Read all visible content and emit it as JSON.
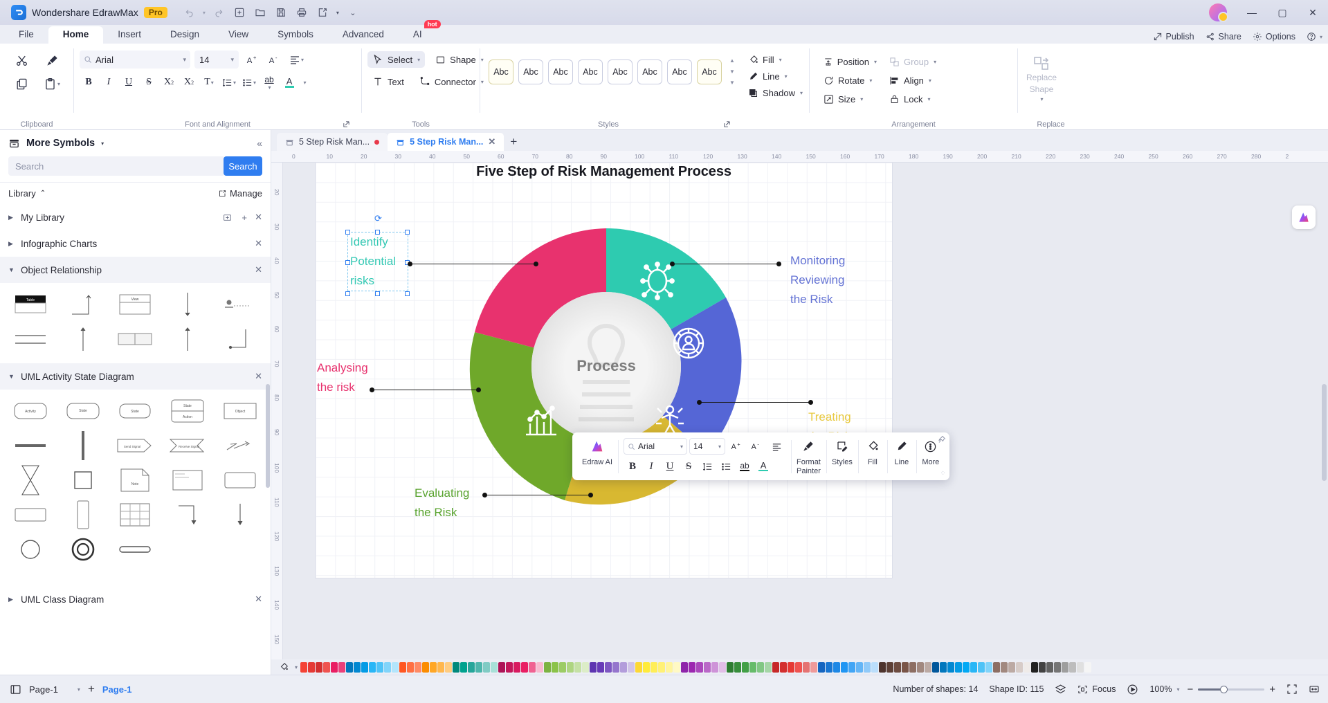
{
  "app": {
    "title": "Wondershare EdrawMax",
    "badge": "Pro"
  },
  "titlebar_icons": [
    "undo-icon",
    "redo-icon",
    "new-icon",
    "open-icon",
    "save-icon",
    "print-icon",
    "export-icon",
    "more-icon"
  ],
  "window_controls": {
    "minimize": "—",
    "maximize": "▢",
    "close": "✕"
  },
  "menu": {
    "items": [
      "File",
      "Home",
      "Insert",
      "Design",
      "View",
      "Symbols",
      "Advanced",
      "AI"
    ],
    "active": "Home",
    "ai_badge": "hot",
    "right": {
      "publish": "Publish",
      "share": "Share",
      "options": "Options",
      "help": "?"
    }
  },
  "ribbon": {
    "groups": [
      "Clipboard",
      "Font and Alignment",
      "Tools",
      "Styles",
      "Arrangement",
      "Replace"
    ],
    "clipboard": {
      "cut": "cut-icon",
      "format_painter": "format-painter-icon",
      "copy": "copy-icon",
      "paste": "paste-icon"
    },
    "font": {
      "family": "Arial",
      "family_placeholder": "Arial",
      "size": "14",
      "buttons": [
        "grow-font",
        "shrink-font",
        "align",
        "bold",
        "italic",
        "underline",
        "strikethrough",
        "superscript",
        "subscript",
        "text-case",
        "line-spacing",
        "bullets",
        "highlight",
        "font-color"
      ]
    },
    "tools": {
      "select": "Select",
      "shape": "Shape",
      "text": "Text",
      "connector": "Connector"
    },
    "styles": {
      "swatches": [
        "Abc",
        "Abc",
        "Abc",
        "Abc",
        "Abc",
        "Abc",
        "Abc",
        "Abc"
      ]
    },
    "fill_group": {
      "fill": "Fill",
      "line": "Line",
      "shadow": "Shadow"
    },
    "arrangement": {
      "position": "Position",
      "group": "Group",
      "rotate": "Rotate",
      "align": "Align",
      "size": "Size",
      "lock": "Lock"
    },
    "replace": {
      "label_line1": "Replace",
      "label_line2": "Shape"
    }
  },
  "sidebar": {
    "header": "More Symbols",
    "search_placeholder": "Search",
    "search_button": "Search",
    "library_label": "Library",
    "manage_label": "Manage",
    "categories": [
      {
        "name": "My Library",
        "open": false
      },
      {
        "name": "Infographic Charts",
        "open": false
      },
      {
        "name": "Object Relationship",
        "open": true
      },
      {
        "name": "UML Activity State Diagram",
        "open": true
      },
      {
        "name": "UML Class Diagram",
        "open": false
      }
    ],
    "object_relationship_shapes": [
      "table",
      "crows-foot",
      "view",
      "arrow-down",
      "entity-actor",
      "relation-lines",
      "arrow-up",
      "two-cell-table",
      "arrow-up-2",
      "elbow-connector"
    ],
    "uml_shapes": [
      "Activity",
      "State",
      "State",
      "State-Action",
      "Object",
      "bar",
      "Send Signal",
      "Receive Signal",
      "transition",
      "merge",
      "decision",
      "Note",
      "callout",
      "rounded-rect",
      "rect",
      "vertical-bar",
      "grid",
      "elbow",
      "arrow-down",
      "circle",
      "final-state",
      "thick-bar"
    ]
  },
  "document_tabs": [
    {
      "title": "5 Step Risk Man...",
      "modified": true,
      "active": false
    },
    {
      "title": "5 Step Risk Man...",
      "modified": false,
      "active": true
    }
  ],
  "canvas": {
    "diagram_title": "Five Step of Risk Management Process",
    "center_text": "Process",
    "labels": [
      {
        "text": "Identify Potential risks",
        "lines": [
          "Identify",
          "Potential",
          "risks"
        ],
        "color": "#35c9b4",
        "selected": true
      },
      {
        "text": "Monitoring Reviewing the Risk",
        "lines": [
          "Monitoring",
          "Reviewing",
          "the Risk"
        ],
        "color": "#6372d4",
        "selected": false
      },
      {
        "text": "Treating the Risk",
        "lines": [
          "Treating",
          "the Risk"
        ],
        "color": "#e8c93f",
        "selected": false
      },
      {
        "text": "Evaluating the Risk",
        "lines": [
          "Evaluating",
          "the Risk"
        ],
        "color": "#59a32f",
        "selected": false
      },
      {
        "text": "Analysing the risk",
        "lines": [
          "Analysing",
          "the risk"
        ],
        "color": "#e8326e",
        "selected": false
      }
    ],
    "segment_colors": [
      "#2ecbb0",
      "#5566d6",
      "#d8b831",
      "#6fa82a",
      "#e8326e"
    ],
    "segment_icons": [
      "bug-icon",
      "gear-person-icon",
      "person-target-icon",
      "bar-chart-icon",
      "pie-chart-icon"
    ],
    "ruler_h_ticks": [
      "0",
      "10",
      "20",
      "30",
      "40",
      "50",
      "60",
      "70",
      "80",
      "90",
      "100",
      "110",
      "120",
      "130",
      "140",
      "150",
      "160",
      "170",
      "180",
      "190",
      "200",
      "210",
      "220",
      "230",
      "240",
      "250",
      "260",
      "270",
      "280",
      "2"
    ],
    "ruler_v_ticks": [
      "20",
      "30",
      "40",
      "50",
      "60",
      "70",
      "80",
      "90",
      "100",
      "110",
      "120",
      "130",
      "140",
      "150"
    ],
    "ai_badge": "AI"
  },
  "float_toolbar": {
    "edraw_ai": "Edraw AI",
    "font_family": "Arial",
    "font_size": "14",
    "format_painter_l1": "Format",
    "format_painter_l2": "Painter",
    "styles": "Styles",
    "fill": "Fill",
    "line": "Line",
    "more": "More"
  },
  "statusbar": {
    "page_select": "Page-1",
    "add_page": "+",
    "page_tab": "Page-1",
    "shape_count": "Number of shapes: 14",
    "shape_id": "Shape ID: 115",
    "focus": "Focus",
    "zoom": "100%"
  },
  "palette": [
    "#f44336",
    "#e53935",
    "#d32f2f",
    "#ef5350",
    "#e91e63",
    "#ec407a",
    "#0277bd",
    "#0288d1",
    "#039be5",
    "#29b6f6",
    "#4fc3f7",
    "#81d4fa",
    "#b3e5fc",
    "#ff5722",
    "#ff7043",
    "#ff8a65",
    "#fb8c00",
    "#ffa726",
    "#ffb74d",
    "#ffcc80",
    "#00897b",
    "#00a28e",
    "#26a69a",
    "#4db6ac",
    "#80cbc4",
    "#a8e0d8",
    "#ad1457",
    "#c2185b",
    "#d81b60",
    "#e91e63",
    "#f06292",
    "#f8bbd0",
    "#7cb342",
    "#8bc34a",
    "#9ccc65",
    "#aed581",
    "#c5e1a5",
    "#dcedc8",
    "#5e35b1",
    "#673ab7",
    "#7e57c2",
    "#9575cd",
    "#b39ddb",
    "#d1c4e9",
    "#fdd835",
    "#ffeb3b",
    "#ffee58",
    "#fff176",
    "#fff59d",
    "#fff9c4",
    "#8e24aa",
    "#9c27b0",
    "#ab47bc",
    "#ba68c8",
    "#ce93d8",
    "#e1bee7",
    "#2e7d32",
    "#388e3c",
    "#43a047",
    "#66bb6a",
    "#81c784",
    "#a5d6a7",
    "#c62828",
    "#d32f2f",
    "#e53935",
    "#ef5350",
    "#e57373",
    "#ef9a9a",
    "#1565c0",
    "#1976d2",
    "#1e88e5",
    "#2196f3",
    "#42a5f5",
    "#64b5f6",
    "#90caf9",
    "#bbdefb",
    "#4e342e",
    "#5d4037",
    "#6d4c41",
    "#795548",
    "#8d6e63",
    "#a1887f",
    "#bcaaa4",
    "#01579b",
    "#0277bd",
    "#0288d1",
    "#039be5",
    "#03a9f4",
    "#29b6f6",
    "#4fc3f7",
    "#81d4fa",
    "#8d6e63",
    "#a1887f",
    "#bcaaa4",
    "#d7ccc8",
    "#efebe9",
    "#212121",
    "#424242",
    "#616161",
    "#757575",
    "#9e9e9e",
    "#bdbdbd",
    "#e0e0e0",
    "#f5f5f5"
  ]
}
